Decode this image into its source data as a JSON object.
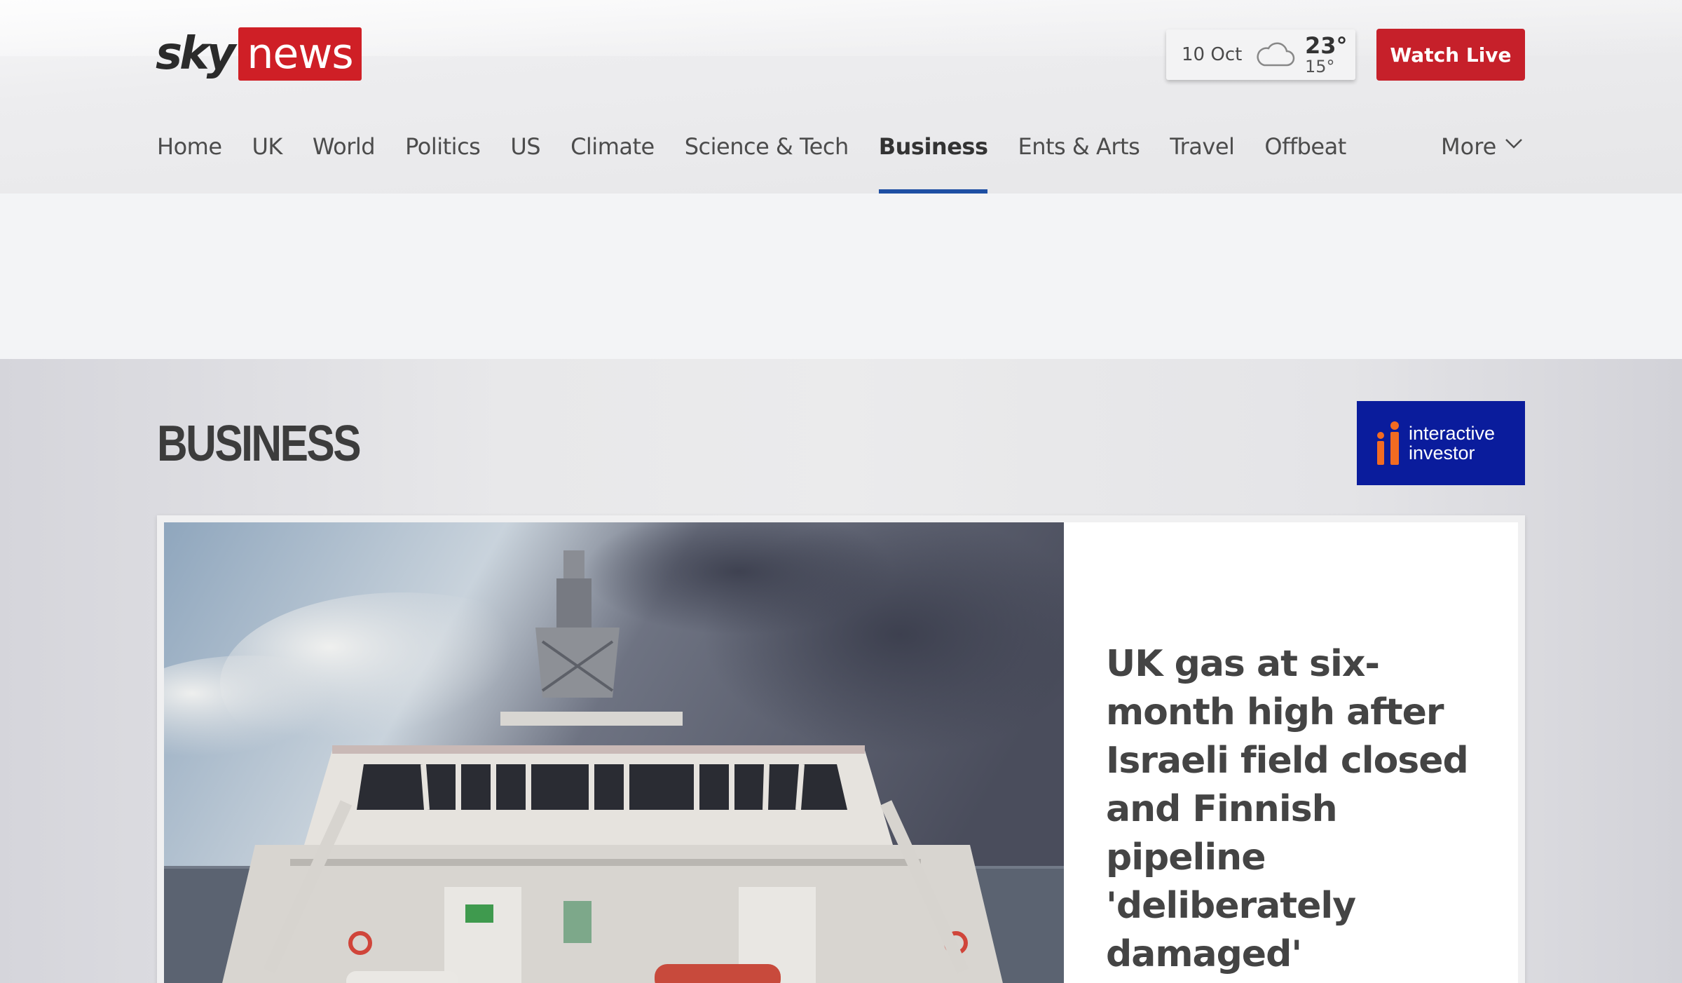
{
  "brand": {
    "sky": "sky",
    "news": "news",
    "accent": "#cf1f26"
  },
  "weather": {
    "date": "10 Oct",
    "icon": "cloud-icon",
    "high": "23°",
    "low": "15°"
  },
  "header": {
    "watch_live": "Watch Live"
  },
  "nav": {
    "items": [
      {
        "label": "Home"
      },
      {
        "label": "UK"
      },
      {
        "label": "World"
      },
      {
        "label": "Politics"
      },
      {
        "label": "US"
      },
      {
        "label": "Climate"
      },
      {
        "label": "Science & Tech"
      },
      {
        "label": "Business",
        "active": true
      },
      {
        "label": "Ents & Arts"
      },
      {
        "label": "Travel"
      },
      {
        "label": "Offbeat"
      }
    ],
    "more": "More"
  },
  "section": {
    "title": "BUSINESS",
    "sponsor": {
      "line1": "interactive",
      "line2": "investor",
      "bg": "#0a1c9c",
      "mark_color": "#f26b21"
    }
  },
  "lead_story": {
    "headline": "UK gas at six-month high after Israeli field closed and Finnish pipeline 'deliberately damaged'",
    "image": "ship-photo"
  }
}
